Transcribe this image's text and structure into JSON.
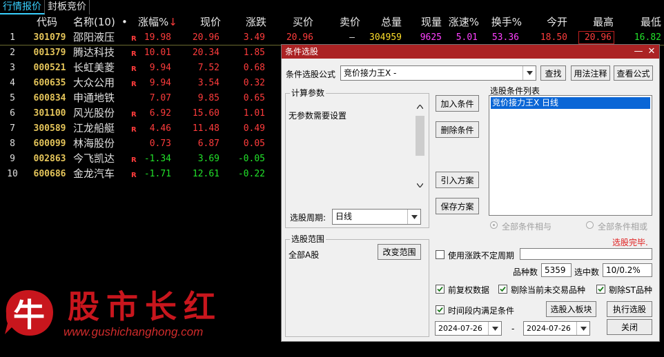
{
  "tabs": [
    "行情报价",
    "封板竞价"
  ],
  "columns": {
    "no": "",
    "code": "代码",
    "name": "名称(10)",
    "dot": "•",
    "pct": "涨幅%",
    "price": "现价",
    "change": "涨跌",
    "bid": "买价",
    "ask": "卖价",
    "volume": "总量",
    "cur_vol": "现量",
    "speed": "涨速%",
    "turnover": "换手%",
    "open": "今开",
    "high": "最高",
    "low": "最低"
  },
  "sort_arrow": "↓",
  "rows": [
    {
      "no": "1",
      "code": "301079",
      "name": "邵阳液压",
      "flag": "R",
      "pct": "19.98",
      "price": "20.96",
      "change": "3.49",
      "bid": "20.96",
      "ask": "–",
      "volume": "304959",
      "cur_vol": "9625",
      "speed": "5.01",
      "turnover": "53.36",
      "open": "18.50",
      "high": "20.96",
      "low": "16.82"
    },
    {
      "no": "2",
      "code": "001379",
      "name": "腾达科技",
      "flag": "R",
      "pct": "10.01",
      "price": "20.34",
      "change": "1.85"
    },
    {
      "no": "3",
      "code": "000521",
      "name": "长虹美菱",
      "flag": "R",
      "pct": "9.94",
      "price": "7.52",
      "change": "0.68"
    },
    {
      "no": "4",
      "code": "600635",
      "name": "大众公用",
      "flag": "R",
      "pct": "9.94",
      "price": "3.54",
      "change": "0.32"
    },
    {
      "no": "5",
      "code": "600834",
      "name": "申通地铁",
      "flag": "",
      "pct": "7.07",
      "price": "9.85",
      "change": "0.65"
    },
    {
      "no": "6",
      "code": "301100",
      "name": "风光股份",
      "flag": "R",
      "pct": "6.92",
      "price": "15.60",
      "change": "1.01"
    },
    {
      "no": "7",
      "code": "300589",
      "name": "江龙船艇",
      "flag": "R",
      "pct": "4.46",
      "price": "11.48",
      "change": "0.49"
    },
    {
      "no": "8",
      "code": "600099",
      "name": "林海股份",
      "flag": "",
      "pct": "0.73",
      "price": "6.87",
      "change": "0.05"
    },
    {
      "no": "9",
      "code": "002863",
      "name": "今飞凯达",
      "flag": "R",
      "pct": "-1.34",
      "price": "3.69",
      "change": "-0.05"
    },
    {
      "no": "10",
      "code": "600686",
      "name": "金龙汽车",
      "flag": "R",
      "pct": "-1.71",
      "price": "12.61",
      "change": "-0.22"
    }
  ],
  "dialog": {
    "title": "条件选股",
    "formula_label": "条件选股公式",
    "formula_value": "竞价接力王X  -",
    "btn_find": "查找",
    "btn_usage": "用法注释",
    "btn_view": "查看公式",
    "params_title": "计算参数",
    "params_text": "无参数需要设置",
    "period_label": "选股周期:",
    "period_value": "日线",
    "btn_add": "加入条件",
    "btn_delete": "删除条件",
    "btn_import": "引入方案",
    "btn_save": "保存方案",
    "list_label": "选股条件列表",
    "list_items": [
      "竞价接力王X  日线"
    ],
    "radio_and": "全部条件相与",
    "radio_or": "全部条件相或",
    "status": "选股完毕.",
    "range_title": "选股范围",
    "range_value": "全部A股",
    "btn_change_range": "改变范围",
    "chk_variable_period": "使用涨跌不定周期",
    "stock_count_label": "品种数",
    "stock_count": "5359",
    "selected_label": "选中数",
    "selected_value": "10/0.2%",
    "chk_prefq": "前复权数据",
    "chk_exclude_notrade": "剔除当前未交易品种",
    "chk_exclude_st": "剔除ST品种",
    "chk_time_range": "时间段内满足条件",
    "btn_to_block": "选股入板块",
    "btn_execute": "执行选股",
    "date_from": "2024-07-26",
    "date_sep": "-",
    "date_to": "2024-07-26",
    "btn_close": "关闭",
    "close_glyph": "✕",
    "min_glyph": "—"
  },
  "watermark": {
    "logo_char": "牛",
    "title": "股市长红",
    "url": "www.gushichanghong.com"
  },
  "colors": {
    "up": "#ff3c3c",
    "down": "#22e22a",
    "code": "#e5c55a",
    "dialog_title": "#ab2324",
    "selection": "#0a66d6"
  }
}
